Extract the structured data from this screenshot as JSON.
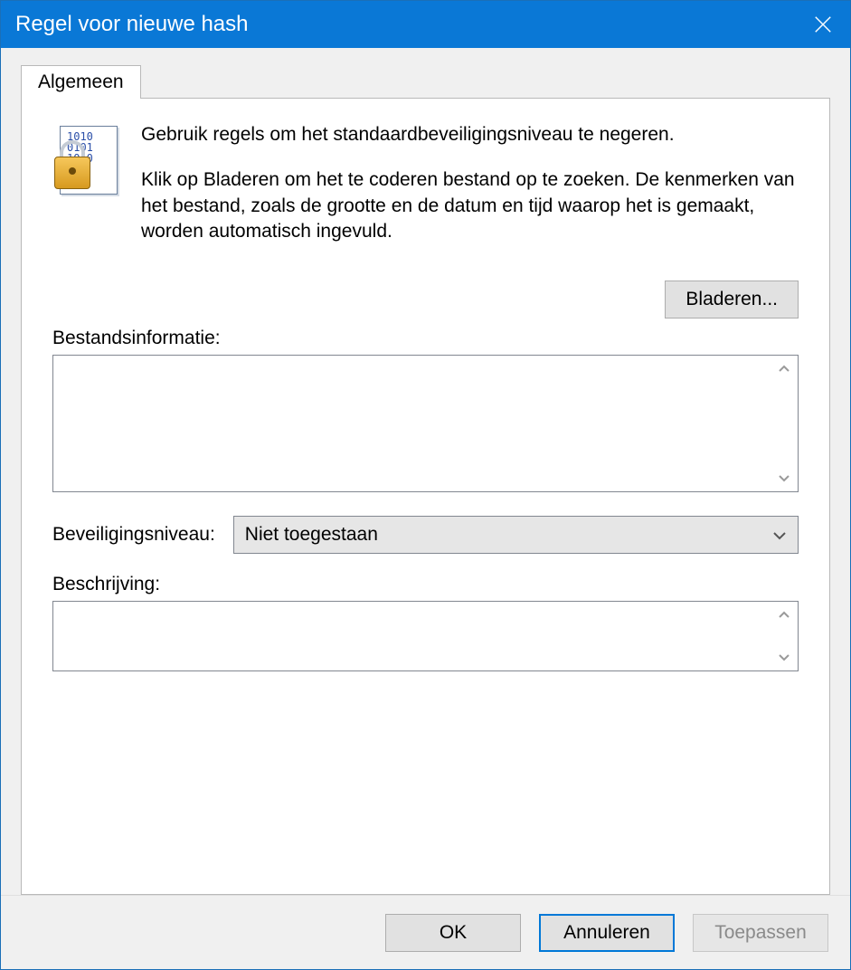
{
  "window": {
    "title": "Regel voor nieuwe hash"
  },
  "tabs": {
    "general": "Algemeen"
  },
  "intro": {
    "line1": "Gebruik regels om het standaardbeveiligingsniveau te negeren.",
    "line2": "Klik op Bladeren om het te coderen bestand op te zoeken. De kenmerken van het bestand, zoals de grootte en de datum en tijd waarop het is gemaakt, worden automatisch ingevuld."
  },
  "buttons": {
    "browse": "Bladeren...",
    "ok": "OK",
    "cancel": "Annuleren",
    "apply": "Toepassen"
  },
  "labels": {
    "file_info": "Bestandsinformatie:",
    "security_level": "Beveiligingsniveau:",
    "description": "Beschrijving:"
  },
  "fields": {
    "file_info_value": "",
    "security_level_value": "Niet toegestaan",
    "description_value": ""
  },
  "icons": {
    "close": "close-icon",
    "lock_doc": "lock-document-icon",
    "chevron_down": "chevron-down-icon",
    "scroll_up": "scroll-up-icon",
    "scroll_down": "scroll-down-icon"
  }
}
